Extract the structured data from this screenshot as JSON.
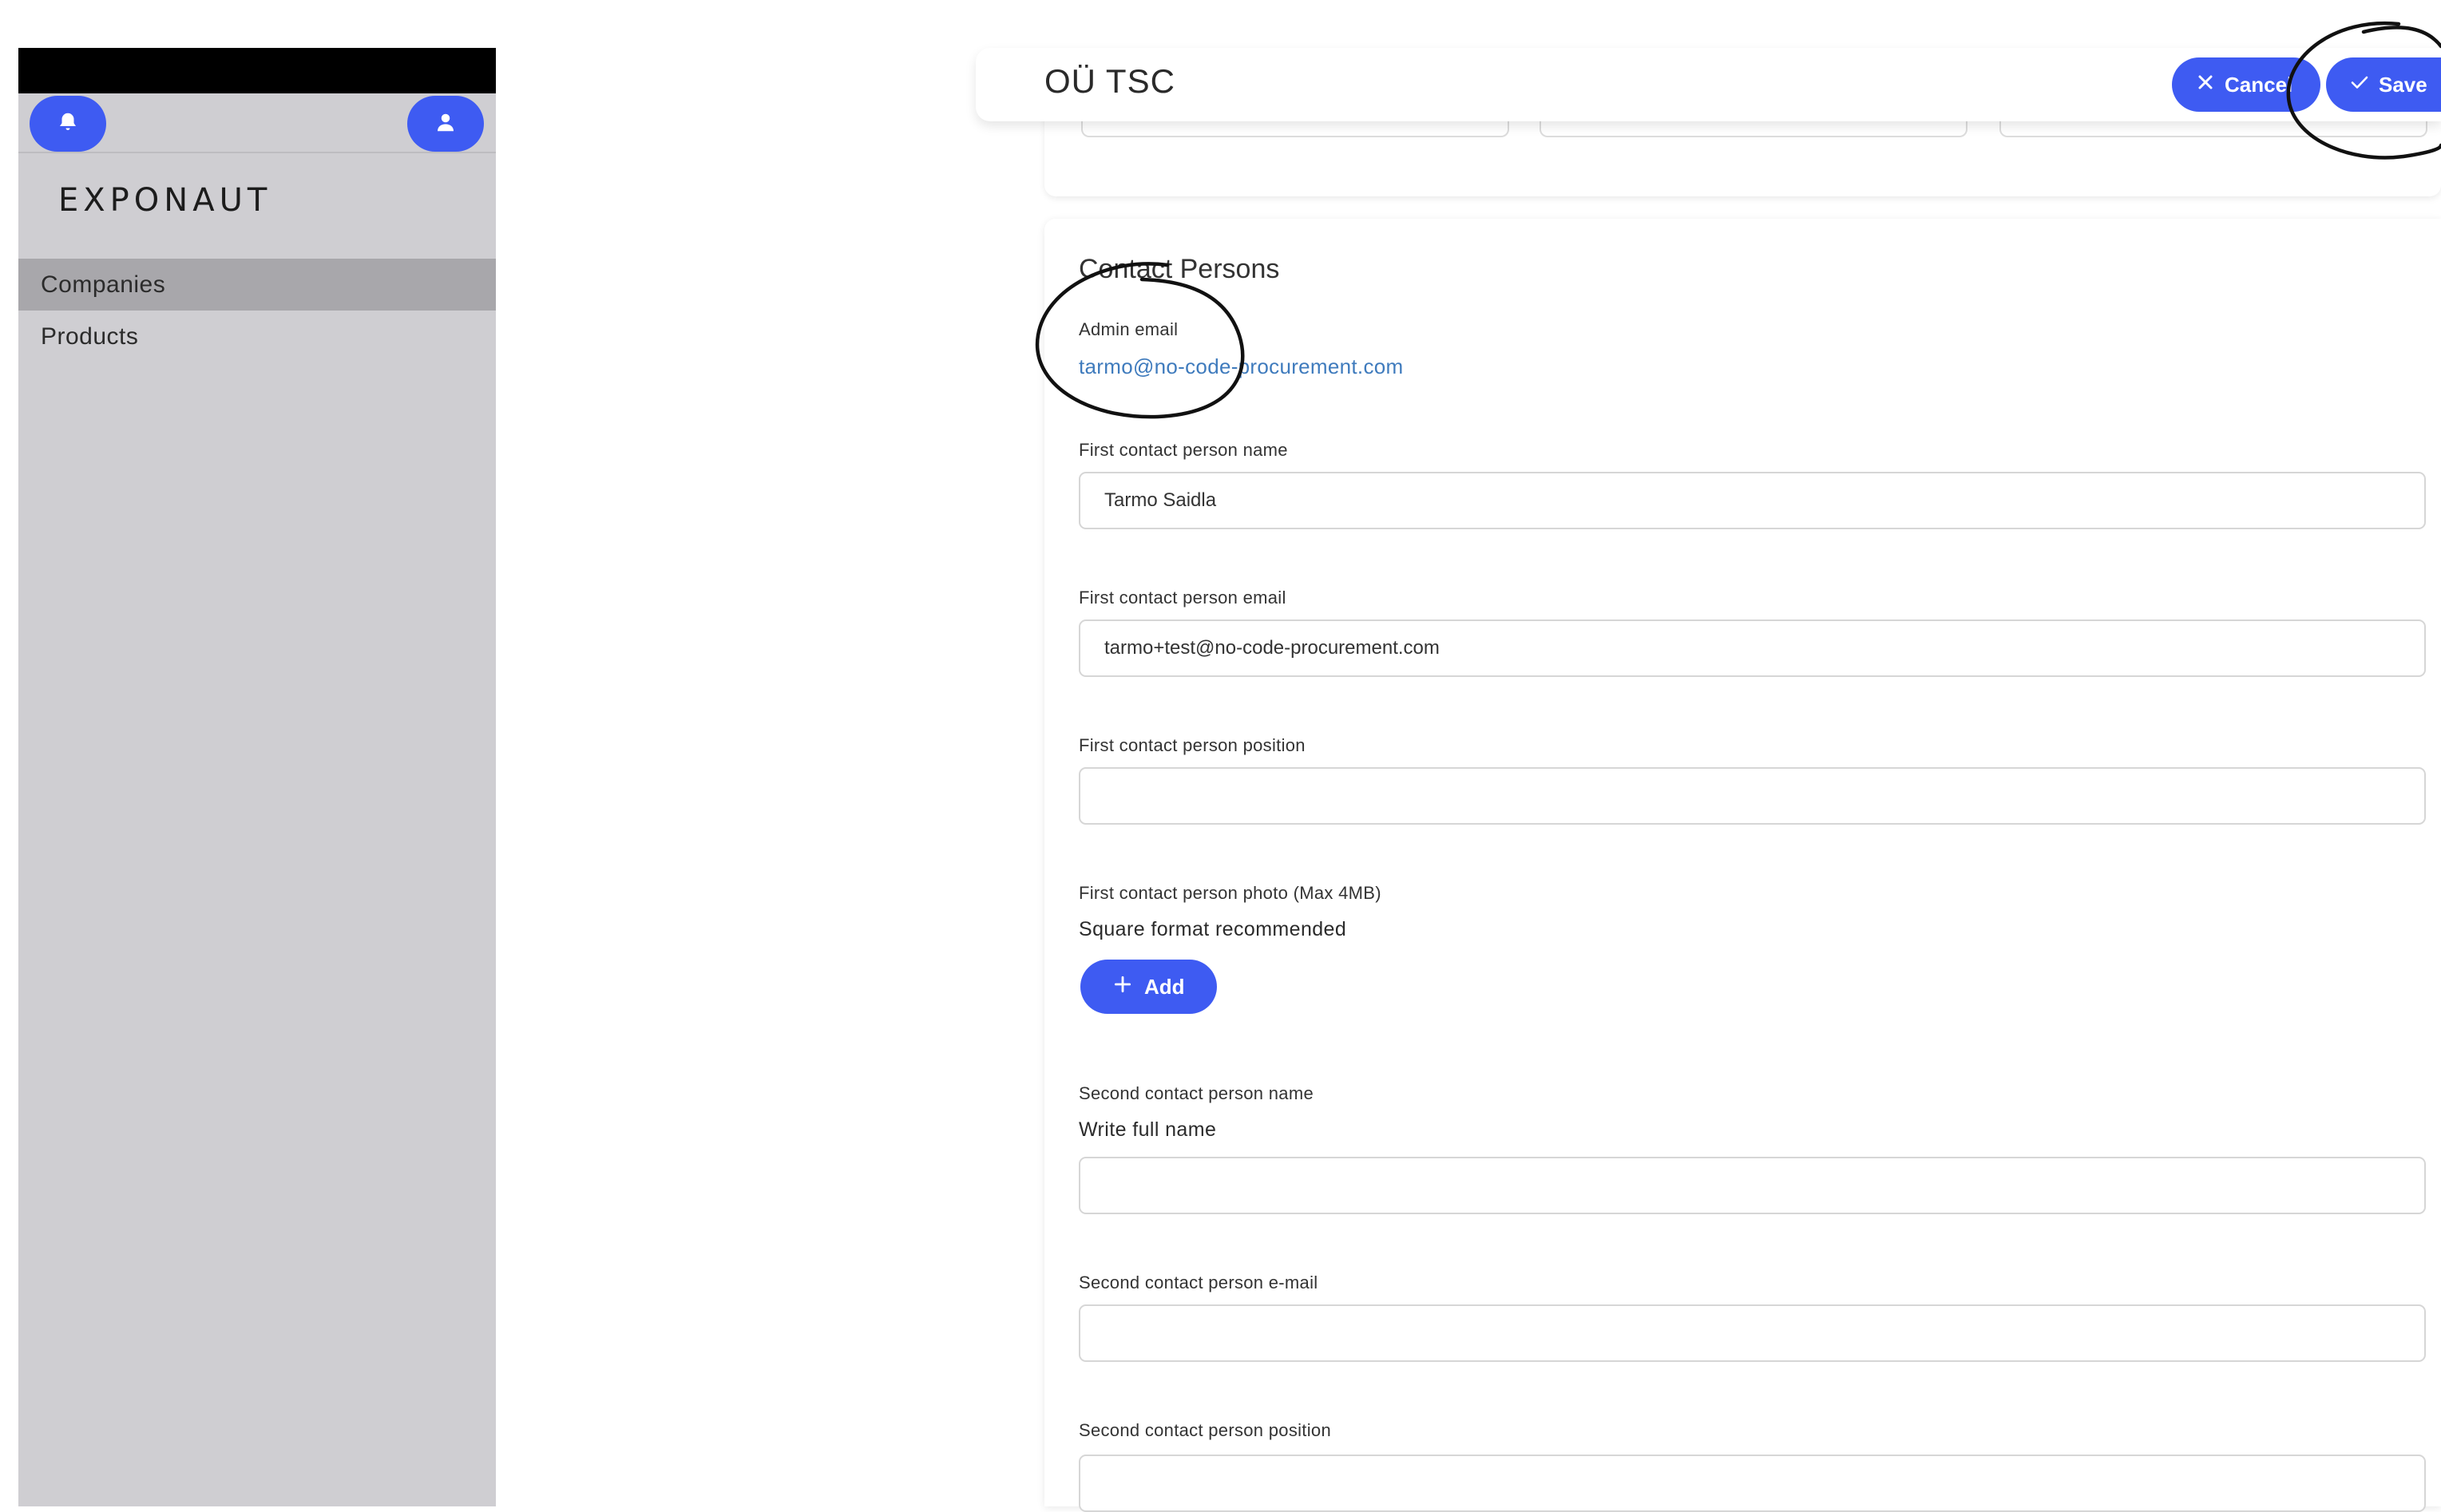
{
  "sidebar": {
    "logo": "EXPONAUT",
    "items": [
      {
        "label": "Companies",
        "active": true
      },
      {
        "label": "Products",
        "active": false
      }
    ],
    "icons": [
      "bell-icon",
      "user-icon"
    ]
  },
  "header": {
    "title": "OÜ TSC",
    "cancel_label": "Cancel",
    "save_label": "Save"
  },
  "contact": {
    "section_title": "Contact Persons",
    "admin_email_label": "Admin email",
    "admin_email_value": "tarmo@no-code-procurement.com",
    "first_name_label": "First contact person name",
    "first_name_value": "Tarmo Saidla",
    "first_email_label": "First contact person email",
    "first_email_value": "tarmo+test@no-code-procurement.com",
    "first_position_label": "First contact person position",
    "first_position_value": "",
    "first_photo_label": "First contact person photo (Max 4MB)",
    "first_photo_hint": "Square format recommended",
    "add_label": "Add",
    "second_name_label": "Second contact person name",
    "second_name_hint": "Write full name",
    "second_name_value": "",
    "second_email_label": "Second contact person e-mail",
    "second_email_value": "",
    "second_position_label": "Second contact person position",
    "second_position_value": ""
  },
  "colors": {
    "accent": "#3e5bf2",
    "sidebar_bg": "#cfced2",
    "sidebar_active": "#a8a7ab",
    "link": "#3f7bbd"
  }
}
